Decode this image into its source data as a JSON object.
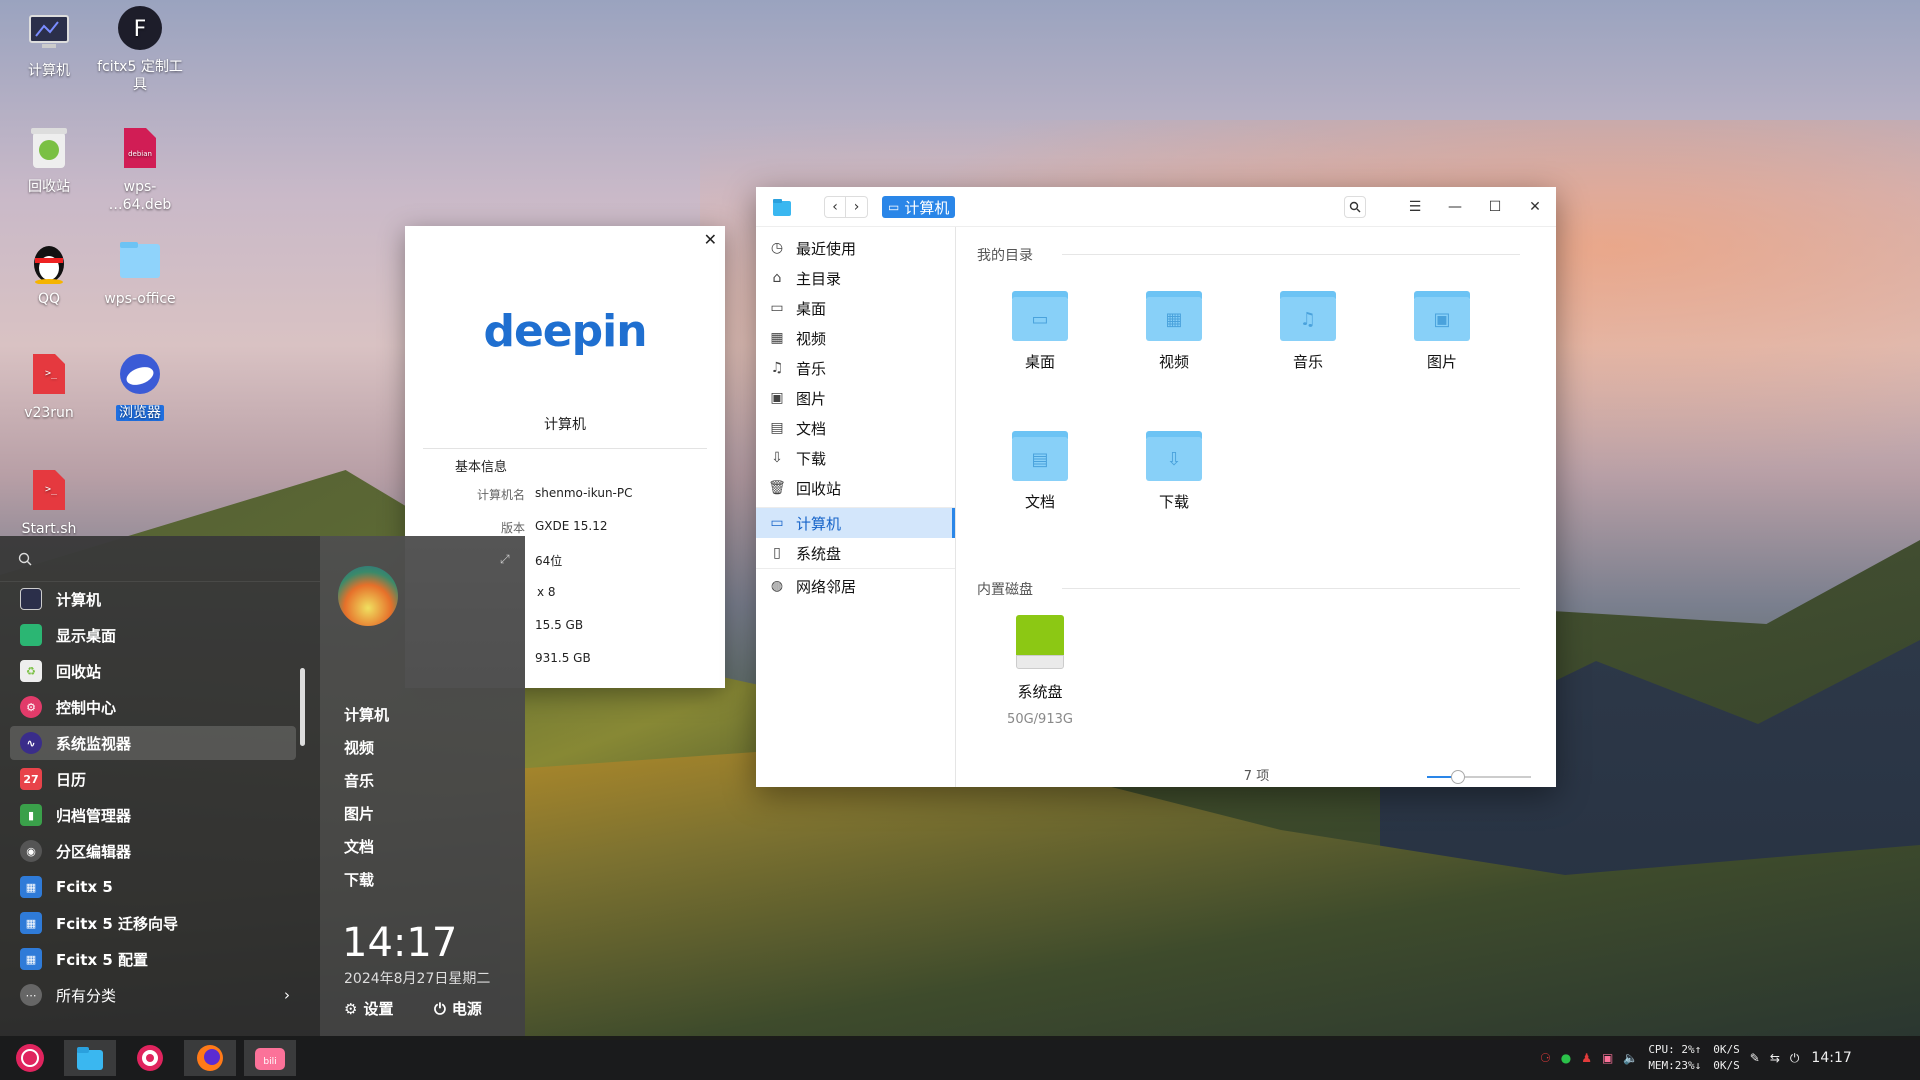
{
  "desktop": {
    "icons": [
      {
        "label": "计算机"
      },
      {
        "label": "fcitx5 定制工具"
      },
      {
        "label": "回收站"
      },
      {
        "label": "wps-\n…64.deb"
      },
      {
        "label": "QQ"
      },
      {
        "label": "wps-office"
      },
      {
        "label": "v23run"
      },
      {
        "label": "浏览器"
      },
      {
        "label": "Start.sh"
      }
    ]
  },
  "about": {
    "logo": "deepin",
    "title": "计算机",
    "section": "基本信息",
    "rows": [
      {
        "key": "计算机名",
        "value": "shenmo-ikun-PC"
      },
      {
        "key": "版本",
        "value": "GXDE 15.12"
      },
      {
        "key": "",
        "value": "64位"
      },
      {
        "key": "",
        "value": "x 8"
      },
      {
        "key": "",
        "value": "15.5 GB"
      },
      {
        "key": "",
        "value": "931.5 GB"
      }
    ]
  },
  "filemanager": {
    "path_label": "计算机",
    "sidebar": [
      {
        "label": "最近使用",
        "icon": "clock-icon"
      },
      {
        "label": "主目录",
        "icon": "home-icon"
      },
      {
        "label": "桌面",
        "icon": "monitor-icon"
      },
      {
        "label": "视频",
        "icon": "film-icon"
      },
      {
        "label": "音乐",
        "icon": "music-icon"
      },
      {
        "label": "图片",
        "icon": "image-icon"
      },
      {
        "label": "文档",
        "icon": "document-icon"
      },
      {
        "label": "下载",
        "icon": "download-icon"
      },
      {
        "label": "回收站",
        "icon": "trash-icon"
      },
      {
        "label": "计算机",
        "icon": "computer-icon"
      },
      {
        "label": "系统盘",
        "icon": "disk-icon"
      },
      {
        "label": "网络邻居",
        "icon": "network-icon"
      }
    ],
    "my_dirs_title": "我的目录",
    "folders": [
      {
        "label": "桌面"
      },
      {
        "label": "视频"
      },
      {
        "label": "音乐"
      },
      {
        "label": "图片"
      },
      {
        "label": "文档"
      },
      {
        "label": "下载"
      }
    ],
    "disks_title": "内置磁盘",
    "disk": {
      "label": "系统盘",
      "usage": "50G/913G"
    },
    "status": "7 项",
    "zoom_level": 0.3
  },
  "menu": {
    "items": [
      {
        "label": "计算机"
      },
      {
        "label": "显示桌面"
      },
      {
        "label": "回收站"
      },
      {
        "label": "控制中心"
      },
      {
        "label": "系统监视器"
      },
      {
        "label": "日历"
      },
      {
        "label": "归档管理器"
      },
      {
        "label": "分区编辑器"
      },
      {
        "label": "Fcitx 5"
      },
      {
        "label": "Fcitx 5 迁移向导"
      },
      {
        "label": "Fcitx 5 配置"
      },
      {
        "label": "所有分类"
      }
    ],
    "calendar_day": "27",
    "right_links": [
      {
        "label": "计算机"
      },
      {
        "label": "视频"
      },
      {
        "label": "音乐"
      },
      {
        "label": "图片"
      },
      {
        "label": "文档"
      },
      {
        "label": "下载"
      }
    ],
    "time": "14:17",
    "date": "2024年8月27日星期二",
    "settings": "设置",
    "power": "电源"
  },
  "taskbar": {
    "cpu": "CPU: 2%",
    "mem": "MEM:23%",
    "net_up": "0K/S",
    "net_down": "0K/S",
    "clock": "14:17"
  },
  "colors": {
    "accent": "#2a86e8",
    "folder": "#88d0f8",
    "disk": "#8cc814"
  }
}
